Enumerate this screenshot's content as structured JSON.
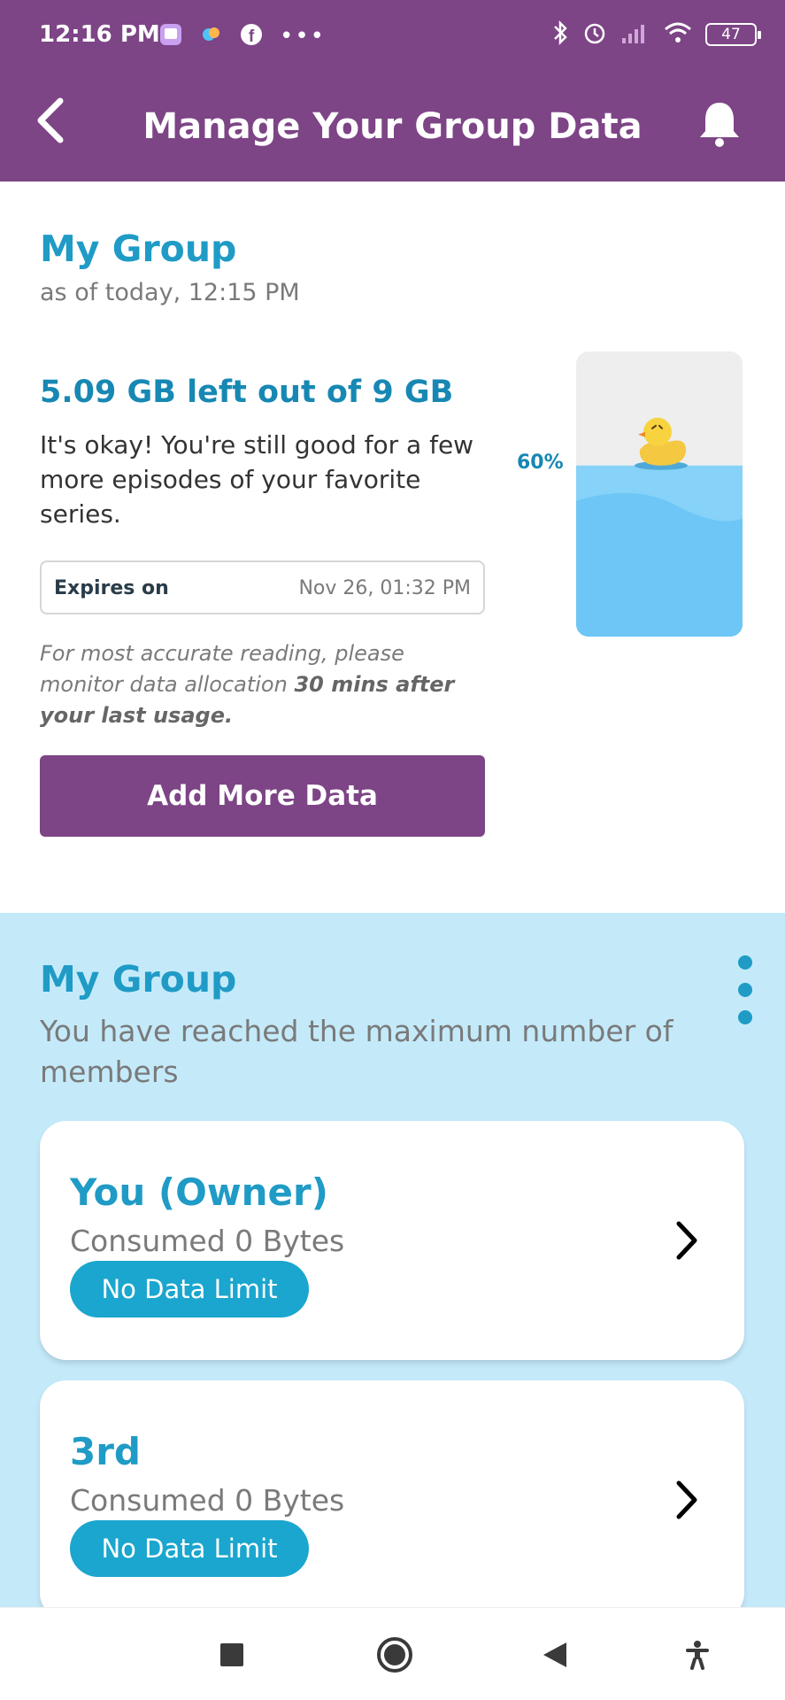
{
  "status_bar": {
    "time": "12:16 PM",
    "battery": "47",
    "left_icons": [
      "app-icon",
      "app-icon",
      "facebook-icon",
      "more-dots-icon"
    ],
    "right_icons": [
      "bluetooth-icon",
      "alarm-icon",
      "signal-icon",
      "wifi-icon",
      "battery-icon"
    ]
  },
  "header": {
    "title": "Manage Your Group Data",
    "back_icon": "chevron-left-icon",
    "bell_icon": "bell-icon"
  },
  "summary": {
    "title": "My Group",
    "as_of": "as of today, 12:15 PM",
    "data_left": "5.09 GB left out of 9 GB",
    "message": "It's okay! You're still good for a few more episodes of your favorite series.",
    "expires_label": "Expires on",
    "expires_value": "Nov 26, 01:32 PM",
    "note_prefix": "For most accurate reading, please monitor data allocation ",
    "note_bold": "30 mins after your last usage.",
    "add_button": "Add More Data",
    "gauge_percent_label": "60%",
    "gauge_fill_fraction": 0.6
  },
  "members": {
    "title": "My Group",
    "subtitle": "You have reached the maximum number of members",
    "items": [
      {
        "name": "You (Owner)",
        "consumed": "Consumed 0 Bytes",
        "badge": "No Data Limit"
      },
      {
        "name": "3rd",
        "consumed": "Consumed 0 Bytes",
        "badge": "No Data Limit"
      }
    ]
  },
  "nav": {
    "buttons": [
      "recents-square-icon",
      "home-circle-icon",
      "back-triangle-icon",
      "accessibility-icon"
    ]
  },
  "colors": {
    "primary_purple": "#7d4486",
    "accent_blue": "#1f9bc6",
    "members_bg": "#c4eafa",
    "badge_blue": "#1aa6ce",
    "water_blue": "#6dc6f5"
  }
}
